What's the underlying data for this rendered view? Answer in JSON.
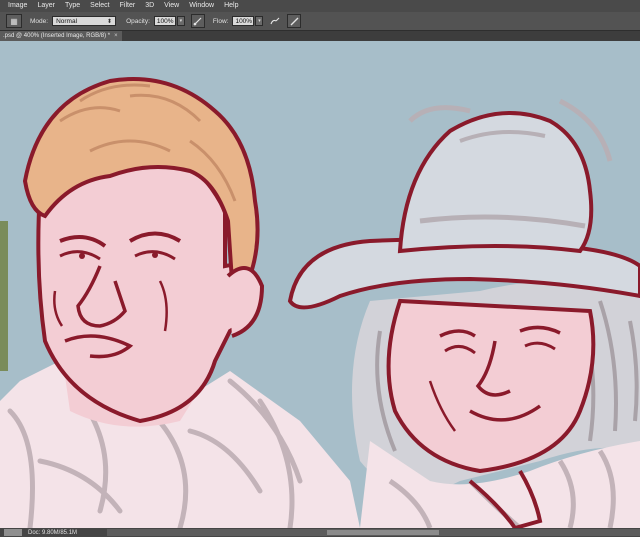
{
  "menubar": {
    "items": [
      "Image",
      "Layer",
      "Type",
      "Select",
      "Filter",
      "3D",
      "View",
      "Window",
      "Help"
    ]
  },
  "options": {
    "mode_label": "Mode:",
    "mode_value": "Normal",
    "opacity_label": "Opacity:",
    "opacity_value": "100%",
    "flow_label": "Flow:",
    "flow_value": "100%",
    "icons": [
      "brush-preset-icon",
      "pressure-opacity-icon",
      "airbrush-icon",
      "pressure-size-icon"
    ]
  },
  "document_tab": {
    "title": ".psd @ 400% (Inserted Image, RGB/8) *",
    "close": "×"
  },
  "status": {
    "doc_info": "Doc: 9.80M/85.1M",
    "arrow": "▶"
  },
  "colors": {
    "canvas_bg": "#a7bec9",
    "ink": "#8a1a2b",
    "skin": "#f3cdd4",
    "hair": "#e8b48a",
    "sketch": "#b7a8ad",
    "hat": "#d4d9e0"
  }
}
